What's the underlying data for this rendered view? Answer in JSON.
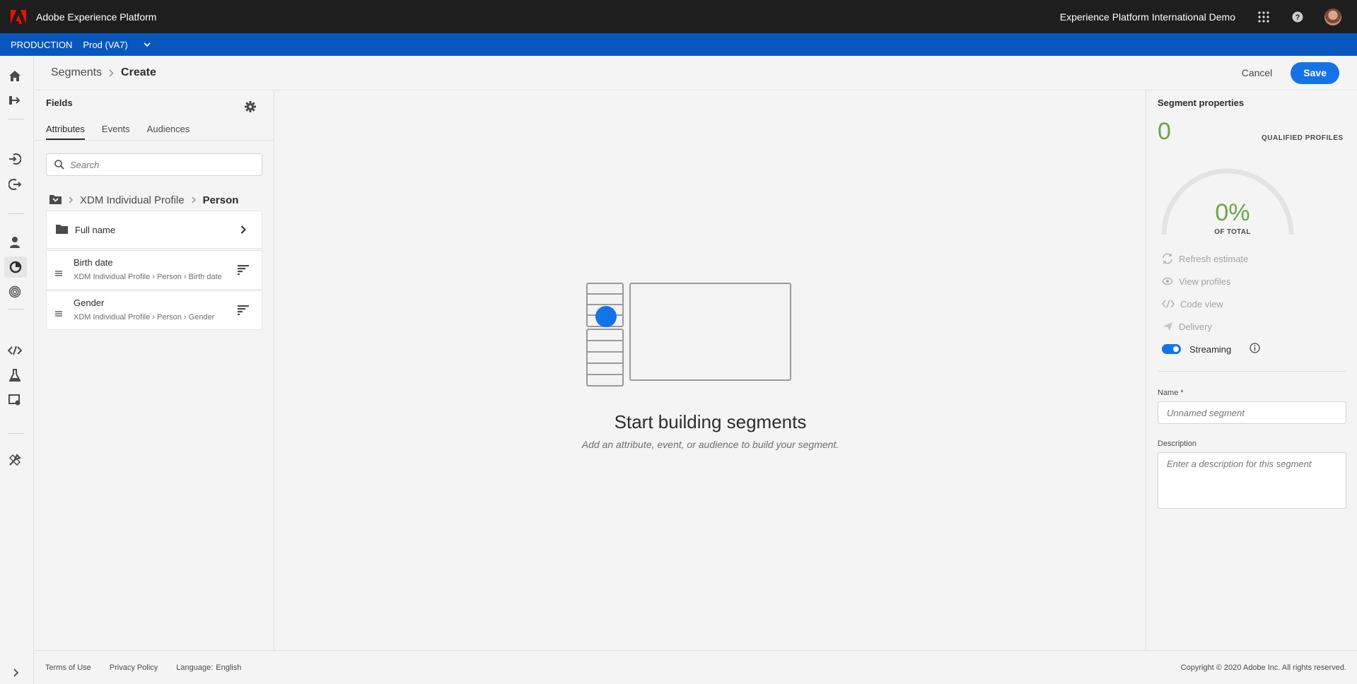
{
  "topbar": {
    "app_title": "Adobe Experience Platform",
    "org_name": "Experience Platform International Demo",
    "icons": [
      "apps-grid-icon",
      "help-icon"
    ]
  },
  "env": {
    "label": "PRODUCTION",
    "sandbox": "Prod (VA7)"
  },
  "breadcrumb": {
    "parent": "Segments",
    "current": "Create"
  },
  "actions": {
    "cancel": "Cancel",
    "save": "Save"
  },
  "fields": {
    "title": "Fields",
    "tabs": [
      "Attributes",
      "Events",
      "Audiences"
    ],
    "active_tab": "Attributes",
    "search_placeholder": "Search",
    "path": [
      "XDM Individual Profile",
      "Person"
    ],
    "items": [
      {
        "type": "folder",
        "name": "Full name"
      },
      {
        "type": "attribute",
        "name": "Birth date",
        "path": [
          "XDM Individual Profile",
          "Person",
          "Birth date"
        ]
      },
      {
        "type": "attribute",
        "name": "Gender",
        "path": [
          "XDM Individual Profile",
          "Person",
          "Gender"
        ]
      }
    ]
  },
  "canvas": {
    "title": "Start building segments",
    "subtitle": "Add an attribute, event, or audience to build your segment."
  },
  "props": {
    "title": "Segment properties",
    "qualified_count": "0",
    "qualified_label": "QUALIFIED PROFILES",
    "percent": "0%",
    "percent_label": "OF TOTAL",
    "actions": [
      "Refresh estimate",
      "View profiles",
      "Code view",
      "Delivery"
    ],
    "streaming_label": "Streaming",
    "streaming_on": true,
    "name_label": "Name *",
    "name_placeholder": "Unnamed segment",
    "desc_label": "Description",
    "desc_placeholder": "Enter a description for this segment"
  },
  "footer": {
    "terms": "Terms of Use",
    "privacy": "Privacy Policy",
    "language_label": "Language:",
    "language_value": "English",
    "copyright": "Copyright ©  2020 Adobe Inc.  All rights reserved."
  },
  "colors": {
    "accent": "#1473e6",
    "env_bar": "#0857be",
    "topbar": "#1e1e1e",
    "positive": "#6da548",
    "adobe_red": "#eb1000"
  }
}
